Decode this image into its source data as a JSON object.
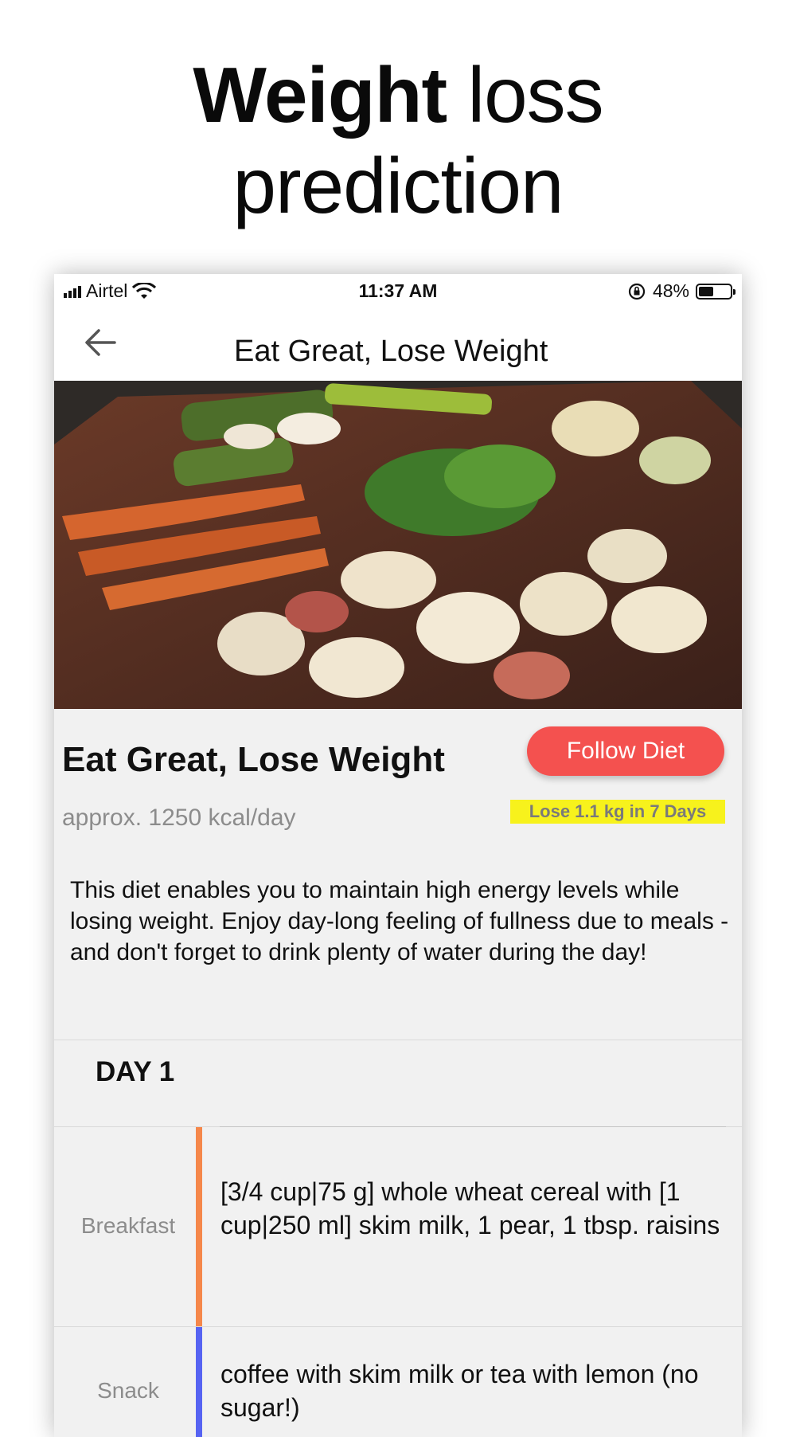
{
  "headline": {
    "bold": "Weight",
    "light_1": "loss",
    "line2": "prediction"
  },
  "status_bar": {
    "carrier": "Airtel",
    "time": "11:37 AM",
    "battery": "48%",
    "battery_level": 0.48
  },
  "nav": {
    "title": "Eat Great, Lose Weight",
    "back_icon": "arrow-left-icon"
  },
  "hero": {
    "description_icon": "vegetables-photo"
  },
  "diet": {
    "title": "Eat Great, Lose Weight",
    "follow_label": "Follow Diet",
    "kcal": "approx. 1250 kcal/day",
    "badge": "Lose 1.1 kg in 7 Days",
    "description": "This diet enables you to maintain high energy levels while losing weight. Enjoy day-long feeling of fullness due to meals - and don't forget to drink plenty of water during the day!"
  },
  "day": {
    "title": "DAY 1"
  },
  "meals": [
    {
      "label": "Breakfast",
      "text": "[3/4 cup|75 g] whole wheat cereal with [1 cup|250 ml] skim milk, 1 pear, 1 tbsp. raisins",
      "color": "#f5874a"
    },
    {
      "label": "Snack",
      "text": "coffee with skim milk or tea with lemon (no sugar!)",
      "color": "#5663f2"
    }
  ],
  "colors": {
    "accent": "#f4514f",
    "badge": "#f7f21c"
  }
}
